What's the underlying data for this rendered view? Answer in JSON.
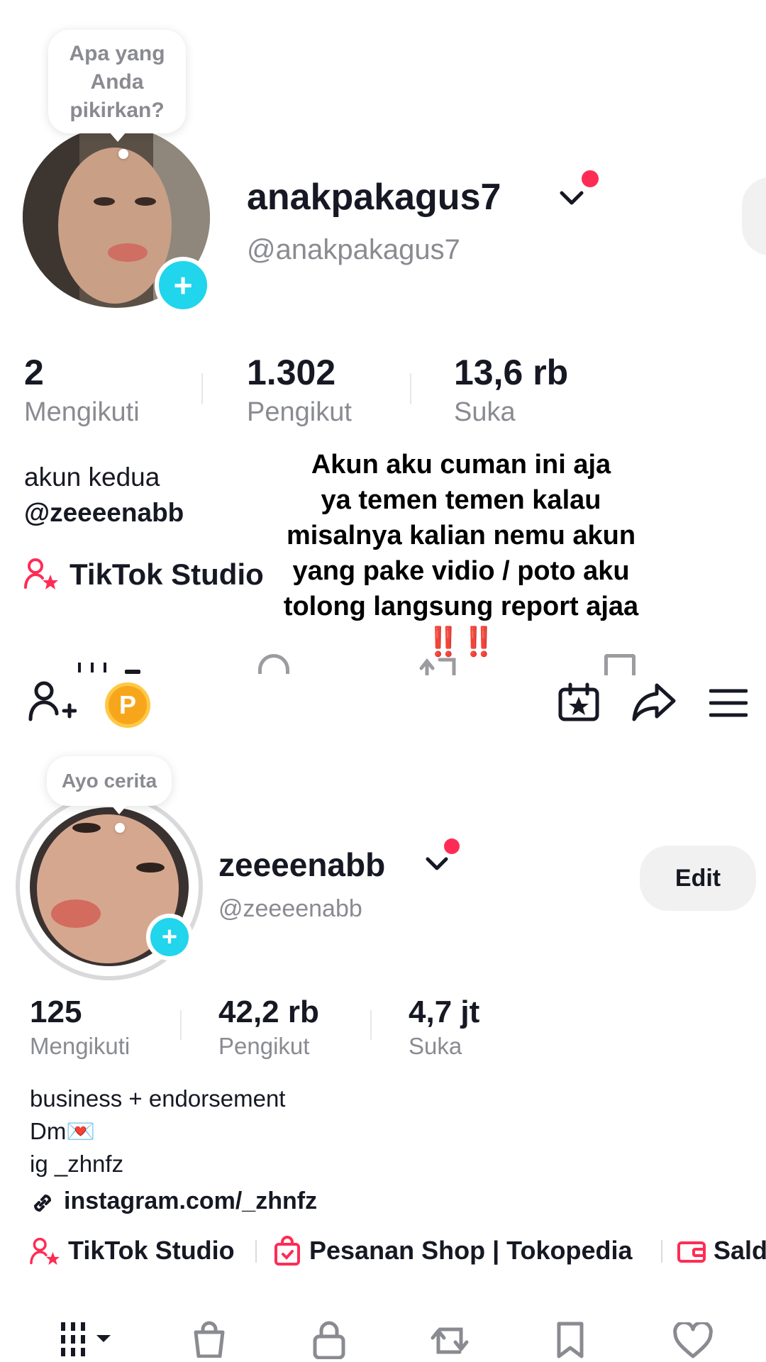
{
  "profile_top": {
    "bubble_text": "Apa yang Anda pikirkan?",
    "display_name": "anakpakagus7",
    "handle": "@anakpakagus7",
    "stats": [
      {
        "value": "2",
        "label": "Mengikuti"
      },
      {
        "value": "1.302",
        "label": "Pengikut"
      },
      {
        "value": "13,6 rb",
        "label": "Suka"
      }
    ],
    "bio_lines": [
      "akun kedua",
      "@zeeeenabb"
    ],
    "studio_label": "TikTok Studio"
  },
  "overlay": {
    "lines": [
      "Akun aku cuman ini aja",
      "ya temen temen kalau",
      "misalnya  kalian nemu akun",
      "yang pake vidio / poto aku",
      "tolong langsung report ajaa"
    ],
    "marks": "‼️‼️"
  },
  "toolbar": {
    "coin_label": "P",
    "icons": [
      "add-friend-icon",
      "coin-icon",
      "calendar-star-icon",
      "share-icon",
      "menu-icon"
    ]
  },
  "profile_bottom": {
    "bubble_text": "Ayo cerita",
    "display_name": "zeeeenabb",
    "handle": "@zeeeenabb",
    "edit_label": "Edit",
    "stats": [
      {
        "value": "125",
        "label": "Mengikuti"
      },
      {
        "value": "42,2 rb",
        "label": "Pengikut"
      },
      {
        "value": "4,7 jt",
        "label": "Suka"
      }
    ],
    "bio_lines": [
      "business + endorsement",
      "Dm💌",
      "ig _zhnfz"
    ],
    "link": "instagram.com/_zhnfz",
    "shortcuts": [
      "TikTok Studio",
      "Pesanan Shop | Tokopedia",
      "Saldo"
    ]
  },
  "tabs": [
    "grid-icon",
    "shop-icon",
    "lock-icon",
    "repost-icon",
    "bookmark-icon",
    "heart-icon"
  ],
  "colors": {
    "accent_red": "#fe2c55",
    "plus_blue": "#20d5ec",
    "coin": "#f7a61c",
    "text": "#161823",
    "muted": "#8a8b91"
  }
}
